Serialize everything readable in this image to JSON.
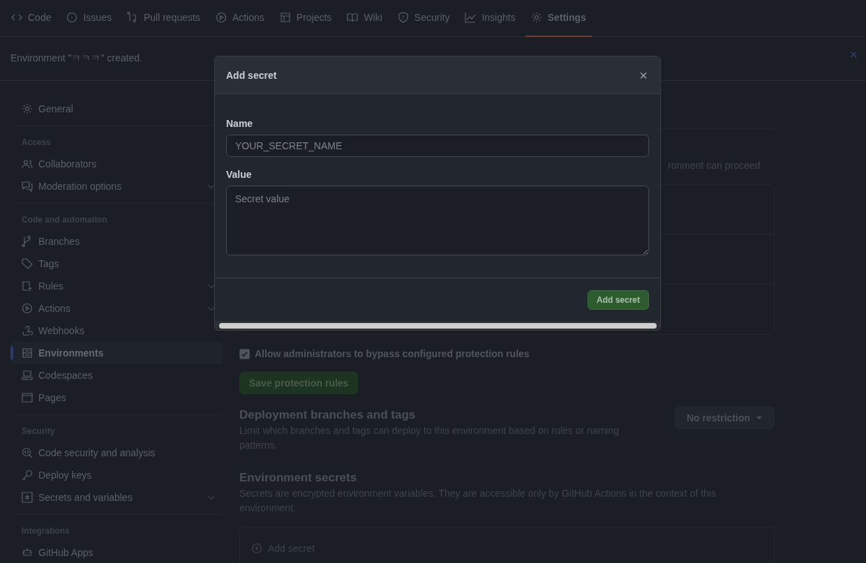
{
  "nav": {
    "tabs": [
      {
        "label": "Code",
        "selected": false
      },
      {
        "label": "Issues",
        "selected": false
      },
      {
        "label": "Pull requests",
        "selected": false
      },
      {
        "label": "Actions",
        "selected": false
      },
      {
        "label": "Projects",
        "selected": false
      },
      {
        "label": "Wiki",
        "selected": false
      },
      {
        "label": "Security",
        "selected": false
      },
      {
        "label": "Insights",
        "selected": false
      },
      {
        "label": "Settings",
        "selected": true
      }
    ]
  },
  "flash": {
    "message": "Environment \"ㅋㅋㅋ\" created.",
    "close": "×"
  },
  "sidebar": {
    "sections": [
      {
        "items": [
          {
            "label": "General",
            "selected": false,
            "expandable": false
          }
        ]
      },
      {
        "heading": "Access",
        "items": [
          {
            "label": "Collaborators",
            "selected": false,
            "expandable": false
          },
          {
            "label": "Moderation options",
            "selected": false,
            "expandable": true
          }
        ]
      },
      {
        "heading": "Code and automation",
        "items": [
          {
            "label": "Branches",
            "selected": false,
            "expandable": false
          },
          {
            "label": "Tags",
            "selected": false,
            "expandable": false
          },
          {
            "label": "Rules",
            "selected": false,
            "expandable": true
          },
          {
            "label": "Actions",
            "selected": false,
            "expandable": true
          },
          {
            "label": "Webhooks",
            "selected": false,
            "expandable": false
          },
          {
            "label": "Environments",
            "selected": true,
            "expandable": false
          },
          {
            "label": "Codespaces",
            "selected": false,
            "expandable": false
          },
          {
            "label": "Pages",
            "selected": false,
            "expandable": false
          }
        ]
      },
      {
        "heading": "Security",
        "items": [
          {
            "label": "Code security and analysis",
            "selected": false,
            "expandable": false
          },
          {
            "label": "Deploy keys",
            "selected": false,
            "expandable": false
          },
          {
            "label": "Secrets and variables",
            "selected": false,
            "expandable": true
          }
        ]
      },
      {
        "heading": "Integrations",
        "items": [
          {
            "label": "GitHub Apps",
            "selected": false,
            "expandable": false
          }
        ]
      }
    ]
  },
  "main": {
    "partial_text": "ronment can proceed.",
    "bypass": {
      "label": "Allow administrators to bypass configured protection rules",
      "checked": true
    },
    "save_button": "Save protection rules",
    "deployment": {
      "title": "Deployment branches and tags",
      "description": "Limit which branches and tags can deploy to this environment based on rules or naming patterns.",
      "dropdown": "No restriction"
    },
    "secrets": {
      "title": "Environment secrets",
      "description": "Secrets are encrypted environment variables. They are accessible only by GitHub Actions in the context of this environment.",
      "add_button": "Add secret"
    }
  },
  "modal": {
    "title": "Add secret",
    "close": "×",
    "fields": [
      {
        "kind": "input",
        "label": "Name",
        "placeholder": "YOUR_SECRET_NAME"
      },
      {
        "kind": "textarea",
        "label": "Value",
        "placeholder": "Secret value"
      }
    ],
    "submit": "Add secret"
  }
}
